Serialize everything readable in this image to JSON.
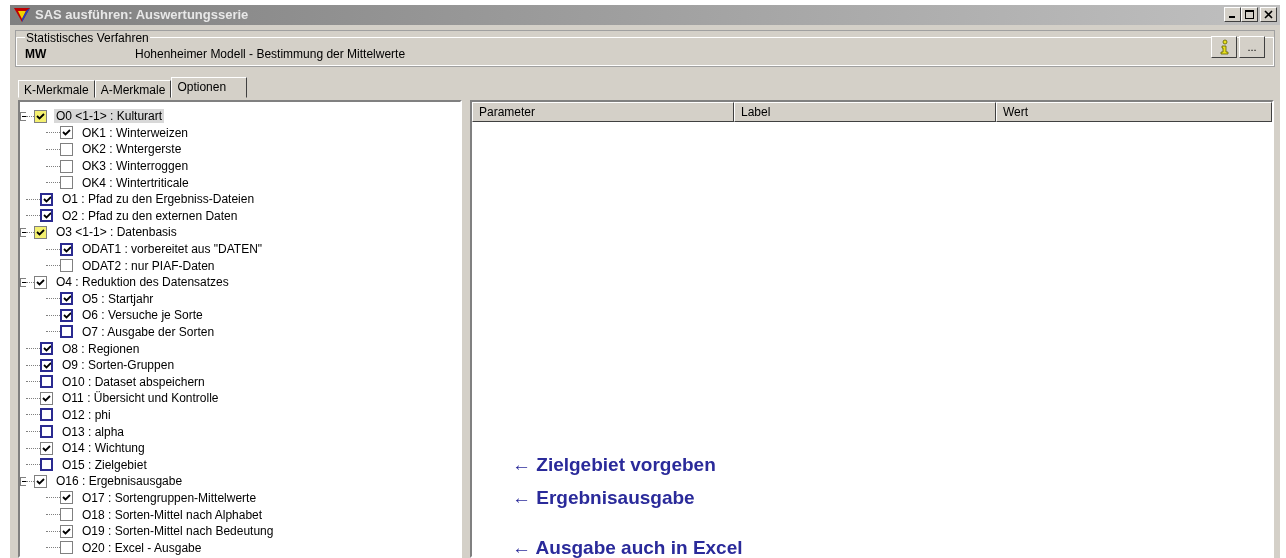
{
  "window": {
    "title": "SAS ausführen: Auswertungsserie"
  },
  "procedure": {
    "legend": "Statistisches Verfahren",
    "code": "MW",
    "description": "Hohenheimer Modell  -  Bestimmung der Mittelwerte",
    "more_button": "..."
  },
  "tabs": [
    {
      "label": "K-Merkmale",
      "selected": false
    },
    {
      "label": "A-Merkmale",
      "selected": false
    },
    {
      "label": "Optionen",
      "selected": true
    }
  ],
  "tree": [
    {
      "label": "O0 <1-1> : Kulturart",
      "kind": "group",
      "checked": true,
      "expanded": true,
      "highlighted": true,
      "children": [
        {
          "label": "OK1 : Winterweizen",
          "kind": "plain",
          "checked": true
        },
        {
          "label": "OK2 : Wntergerste",
          "kind": "plain",
          "checked": false
        },
        {
          "label": "OK3 : Winterroggen",
          "kind": "plain",
          "checked": false
        },
        {
          "label": "OK4 : Wintertriticale",
          "kind": "plain",
          "checked": false
        }
      ]
    },
    {
      "label": "O1 : Pfad zu den Ergebniss-Dateien",
      "kind": "option",
      "checked": true
    },
    {
      "label": "O2 : Pfad zu den externen Daten",
      "kind": "option",
      "checked": true
    },
    {
      "label": "O3 <1-1> : Datenbasis",
      "kind": "group",
      "checked": true,
      "expanded": true,
      "children": [
        {
          "label": "ODAT1 : vorbereitet aus \"DATEN\"",
          "kind": "option",
          "checked": true
        },
        {
          "label": "ODAT2 : nur PIAF-Daten",
          "kind": "plain",
          "checked": false
        }
      ]
    },
    {
      "label": "O4 : Reduktion des Datensatzes",
      "kind": "plain",
      "checked": true,
      "expanded": true,
      "children": [
        {
          "label": "O5 : Startjahr",
          "kind": "option",
          "checked": true
        },
        {
          "label": "O6 : Versuche je Sorte",
          "kind": "option",
          "checked": true
        },
        {
          "label": "O7 : Ausgabe der Sorten",
          "kind": "option",
          "checked": false
        }
      ]
    },
    {
      "label": "O8 : Regionen",
      "kind": "option",
      "checked": true
    },
    {
      "label": "O9 : Sorten-Gruppen",
      "kind": "option",
      "checked": true
    },
    {
      "label": "O10 : Dataset abspeichern",
      "kind": "option",
      "checked": false
    },
    {
      "label": "O11 : Übersicht und Kontrolle",
      "kind": "plain",
      "checked": true
    },
    {
      "label": "O12 : phi",
      "kind": "option",
      "checked": false
    },
    {
      "label": "O13 : alpha",
      "kind": "option",
      "checked": false
    },
    {
      "label": "O14 : Wichtung",
      "kind": "plain",
      "checked": true
    },
    {
      "label": "O15 : Zielgebiet",
      "kind": "option",
      "checked": false,
      "note": "← Zielgebiet vorgeben"
    },
    {
      "label": "O16 : Ergebnisausgabe",
      "kind": "plain",
      "checked": true,
      "expanded": true,
      "children": [
        {
          "label": "O17 : Sortengruppen-Mittelwerte",
          "kind": "plain",
          "checked": true,
          "note": "← Ergebnisausgabe"
        },
        {
          "label": "O18 : Sorten-Mittel nach Alphabet",
          "kind": "plain",
          "checked": false
        },
        {
          "label": "O19 : Sorten-Mittel nach Bedeutung",
          "kind": "plain",
          "checked": true
        },
        {
          "label": "O20 : Excel - Ausgabe",
          "kind": "plain",
          "checked": false,
          "note": "← Ausgabe auch in Excel"
        }
      ]
    }
  ],
  "table": {
    "columns": [
      "Parameter",
      "Label",
      "Wert"
    ]
  }
}
